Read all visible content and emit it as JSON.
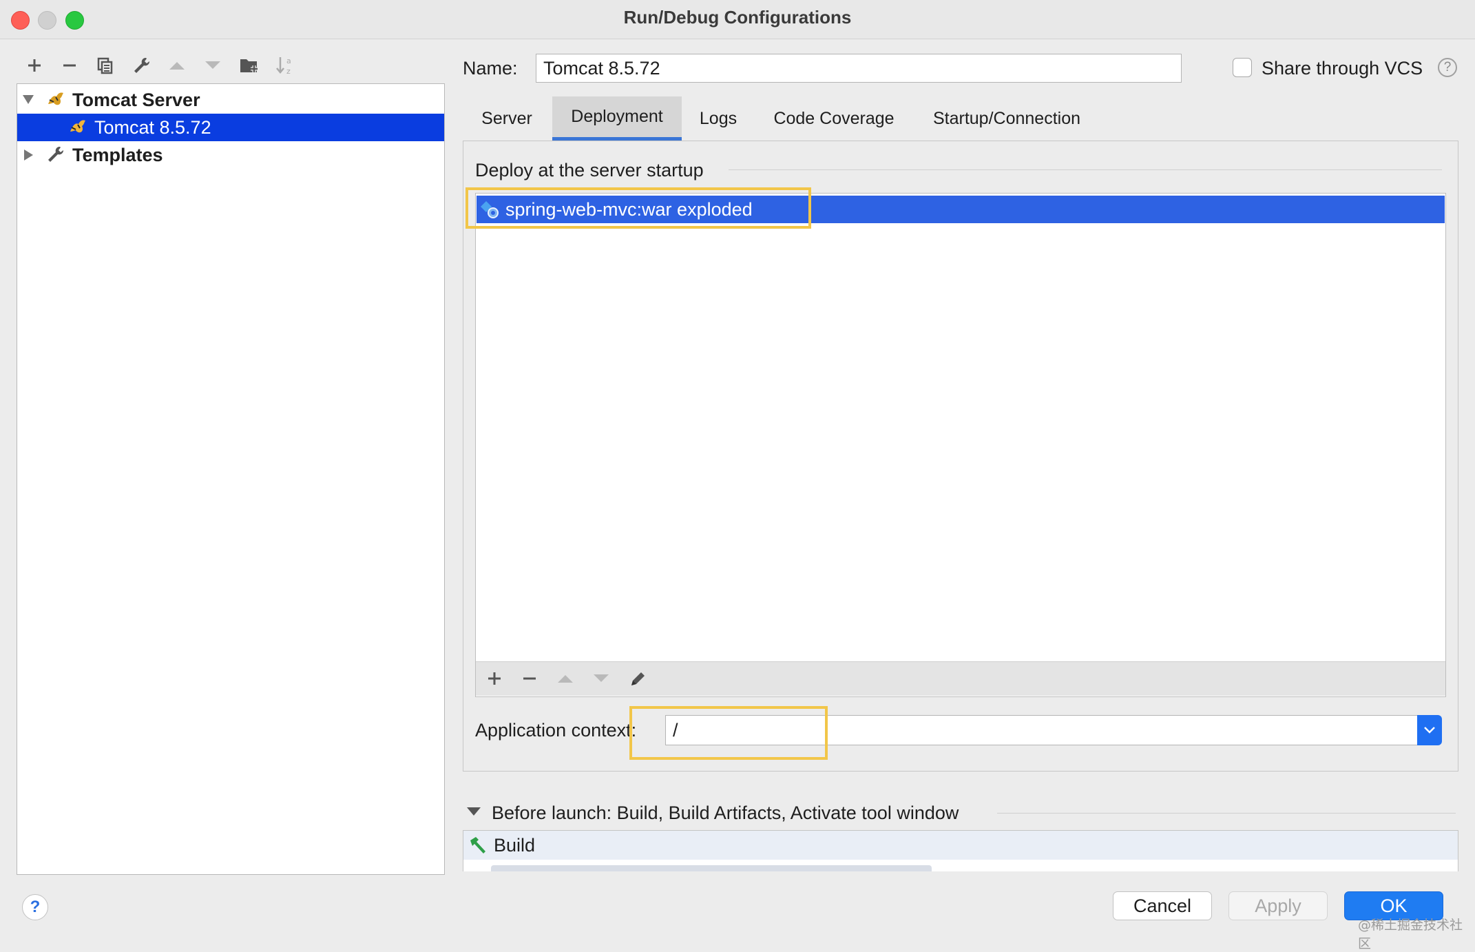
{
  "window": {
    "title": "Run/Debug Configurations"
  },
  "left_toolbar": {
    "icons": [
      "add-icon",
      "remove-icon",
      "copy-icon",
      "wrench-icon",
      "move-up-icon",
      "move-down-icon",
      "new-folder-icon",
      "sort-icon"
    ]
  },
  "tree": {
    "group_label": "Tomcat Server",
    "child_label": "Tomcat 8.5.72",
    "templates_label": "Templates"
  },
  "name_row": {
    "label": "Name:",
    "value": "Tomcat 8.5.72",
    "share_label": "Share through VCS",
    "share_checked": false
  },
  "tabs": [
    "Server",
    "Deployment",
    "Logs",
    "Code Coverage",
    "Startup/Connection"
  ],
  "active_tab": "Deployment",
  "deployment": {
    "section_label": "Deploy at the server startup",
    "artifacts": [
      "spring-web-mvc:war exploded"
    ],
    "app_context_label": "Application context:",
    "app_context_value": "/"
  },
  "before_launch": {
    "label": "Before launch: Build, Build Artifacts, Activate tool window",
    "items": [
      "Build"
    ]
  },
  "buttons": {
    "cancel": "Cancel",
    "apply": "Apply",
    "ok": "OK"
  },
  "watermark": "@稀土掘金技术社区",
  "colors": {
    "selection": "#0a3de0",
    "list_selection": "#2e62e3",
    "highlight_box": "#f2c649",
    "ok_button": "#1f7cf2"
  }
}
